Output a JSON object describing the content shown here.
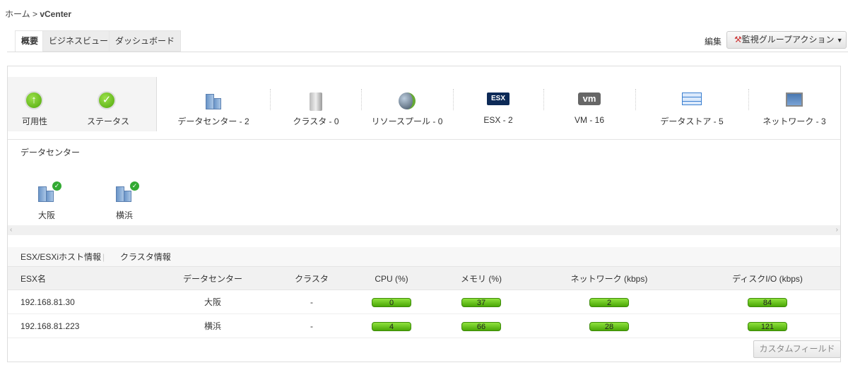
{
  "breadcrumb": {
    "home": "ホーム",
    "sep": ">",
    "current": "vCenter"
  },
  "tabs": [
    "概要",
    "ビジネスビュー",
    "ダッシュボード"
  ],
  "header": {
    "edit": "編集",
    "action_button": "監視グループアクション"
  },
  "status": {
    "availability": "可用性",
    "status": "ステータス"
  },
  "summary": [
    {
      "label": "データセンター - 2",
      "icon": "datacenter-icon"
    },
    {
      "label": "クラスタ - 0",
      "icon": "cluster-icon"
    },
    {
      "label": "リソースプール - 0",
      "icon": "resource-pool-icon"
    },
    {
      "label": "ESX - 2",
      "icon": "esx-icon"
    },
    {
      "label": "VM - 16",
      "icon": "vm-icon"
    },
    {
      "label": "データストア - 5",
      "icon": "datastore-icon"
    },
    {
      "label": "ネットワーク - 3",
      "icon": "network-icon"
    }
  ],
  "icon_text": {
    "esx": "ESX",
    "vm": "vm"
  },
  "datacenters": {
    "title": "データセンター",
    "items": [
      "大阪",
      "横浜"
    ]
  },
  "subtabs": [
    "ESX/ESXiホスト情報",
    "クラスタ情報"
  ],
  "table": {
    "columns": [
      "ESX名",
      "データセンター",
      "クラスタ",
      "CPU (%)",
      "メモリ (%)",
      "ネットワーク (kbps)",
      "ディスクI/O (kbps)"
    ],
    "rows": [
      [
        "192.168.81.30",
        "大阪",
        "-",
        "0",
        "37",
        "2",
        "84"
      ],
      [
        "192.168.81.223",
        "横浜",
        "-",
        "4",
        "66",
        "28",
        "121"
      ]
    ]
  },
  "custom_field_button": "カスタムフィールド",
  "colors": {
    "green": "#4aa707",
    "esx_bg": "#0d2a57",
    "vm_bg": "#666666"
  }
}
